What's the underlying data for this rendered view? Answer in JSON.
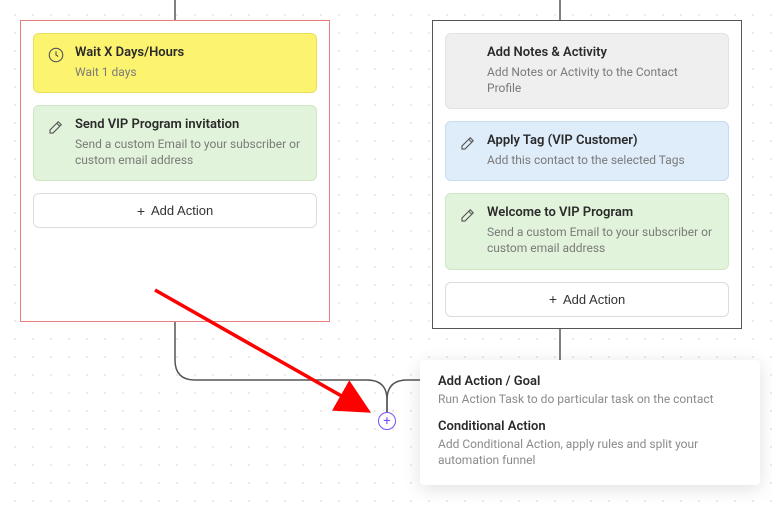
{
  "left_panel": {
    "wait": {
      "title": "Wait X Days/Hours",
      "desc": "Wait 1 days"
    },
    "email": {
      "title": "Send VIP Program invitation",
      "desc": "Send a custom Email to your subscriber or custom email address"
    },
    "add_action": "Add Action"
  },
  "right_panel": {
    "notes": {
      "title": "Add Notes & Activity",
      "desc": "Add Notes or Activity to the Contact Profile"
    },
    "tag": {
      "title": "Apply Tag (VIP Customer)",
      "desc": "Add this contact to the selected Tags"
    },
    "welcome": {
      "title": "Welcome to VIP Program",
      "desc": "Send a custom Email to your subscriber or custom email address"
    },
    "add_action": "Add Action"
  },
  "popup": {
    "opt1": {
      "title": "Add Action / Goal",
      "desc": "Run Action Task to do particular task on the contact"
    },
    "opt2": {
      "title": "Conditional Action",
      "desc": "Add Conditional Action, apply rules and split your automation funnel"
    }
  }
}
